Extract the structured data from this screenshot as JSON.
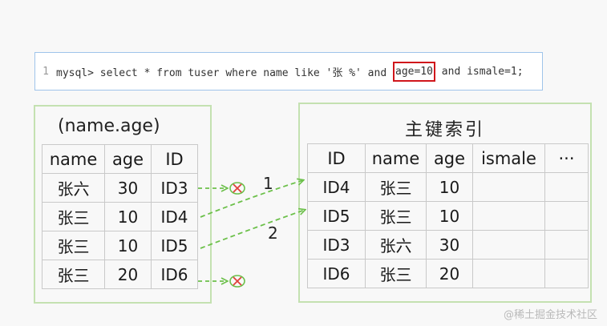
{
  "sql": {
    "line_number": "1",
    "before": "mysql> select * from tuser where name like '张 %' and ",
    "highlight": "age=10",
    "after": " and ismale=1;",
    "highlight_color": "#d0161b"
  },
  "index_table": {
    "title": "(name.age)",
    "headers": [
      "name",
      "age",
      "ID"
    ],
    "rows": [
      [
        "张六",
        "30",
        "ID3"
      ],
      [
        "张三",
        "10",
        "ID4"
      ],
      [
        "张三",
        "10",
        "ID5"
      ],
      [
        "张三",
        "20",
        "ID6"
      ]
    ]
  },
  "primary_table": {
    "title": "主键索引",
    "headers": [
      "ID",
      "name",
      "age",
      "ismale",
      "···"
    ],
    "rows": [
      [
        "ID4",
        "张三",
        "10",
        "",
        ""
      ],
      [
        "ID5",
        "张三",
        "10",
        "",
        ""
      ],
      [
        "ID3",
        "张六",
        "30",
        "",
        ""
      ],
      [
        "ID6",
        "张三",
        "20",
        "",
        ""
      ]
    ]
  },
  "arrow_labels": [
    "1",
    "2"
  ],
  "arrow_color": "#6cc04a",
  "reject_color": "#e0413b",
  "watermark": "@稀土掘金技术社区"
}
